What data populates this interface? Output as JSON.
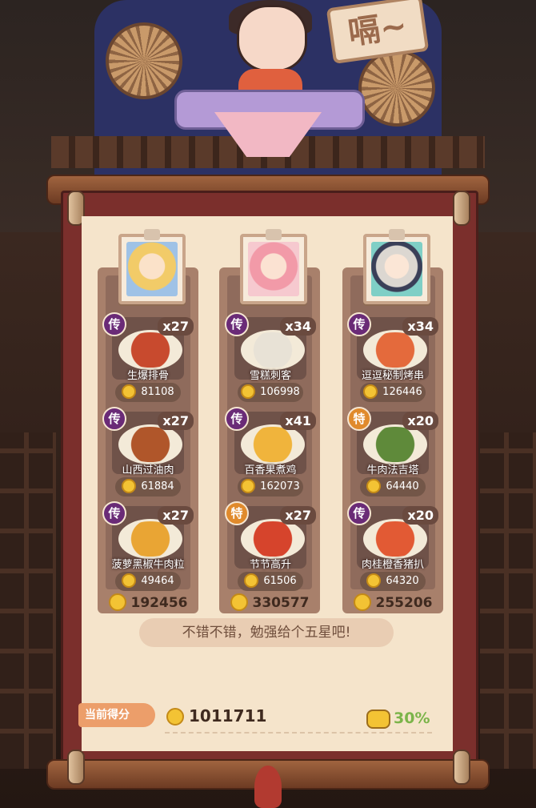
{
  "header": {
    "sign_text": "嗝~"
  },
  "columns": [
    {
      "portrait": "blonde-hero-portrait",
      "dishes": [
        {
          "badge": "传",
          "badge_type": "purple",
          "count": "x27",
          "name": "生爆排骨",
          "score": "81108",
          "food_color": "#c84a2e"
        },
        {
          "badge": "传",
          "badge_type": "purple",
          "count": "x27",
          "name": "山西过油肉",
          "score": "61884",
          "food_color": "#b0562a"
        },
        {
          "badge": "传",
          "badge_type": "purple",
          "count": "x27",
          "name": "菠萝黑椒牛肉粒",
          "score": "49464",
          "food_color": "#e9a534"
        }
      ],
      "total": "192456"
    },
    {
      "portrait": "pink-hair-hero-portrait",
      "dishes": [
        {
          "badge": "传",
          "badge_type": "purple",
          "count": "x34",
          "name": "雪糕刺客",
          "score": "106998",
          "food_color": "#e8e2d6"
        },
        {
          "badge": "传",
          "badge_type": "purple",
          "count": "x41",
          "name": "百香果煮鸡",
          "score": "162073",
          "food_color": "#f0b43c"
        },
        {
          "badge": "特",
          "badge_type": "gold",
          "count": "x27",
          "name": "节节高升",
          "score": "61506",
          "food_color": "#d6442c"
        }
      ],
      "total": "330577"
    },
    {
      "portrait": "silver-hair-hero-portrait",
      "dishes": [
        {
          "badge": "传",
          "badge_type": "purple",
          "count": "x34",
          "name": "逗逗秘制烤串",
          "score": "126446",
          "food_color": "#e46a3c"
        },
        {
          "badge": "特",
          "badge_type": "gold",
          "count": "x20",
          "name": "牛肉法吉塔",
          "score": "64440",
          "food_color": "#5f8a3a"
        },
        {
          "badge": "传",
          "badge_type": "purple",
          "count": "x20",
          "name": "肉桂橙香猪扒",
          "score": "64320",
          "food_color": "#e25a34"
        }
      ],
      "total": "255206"
    }
  ],
  "comment": "不错不错，勉强给个五星吧!",
  "footer": {
    "score_label": "当前得分",
    "score_total": "1011711",
    "bonus_percent": "30%"
  }
}
